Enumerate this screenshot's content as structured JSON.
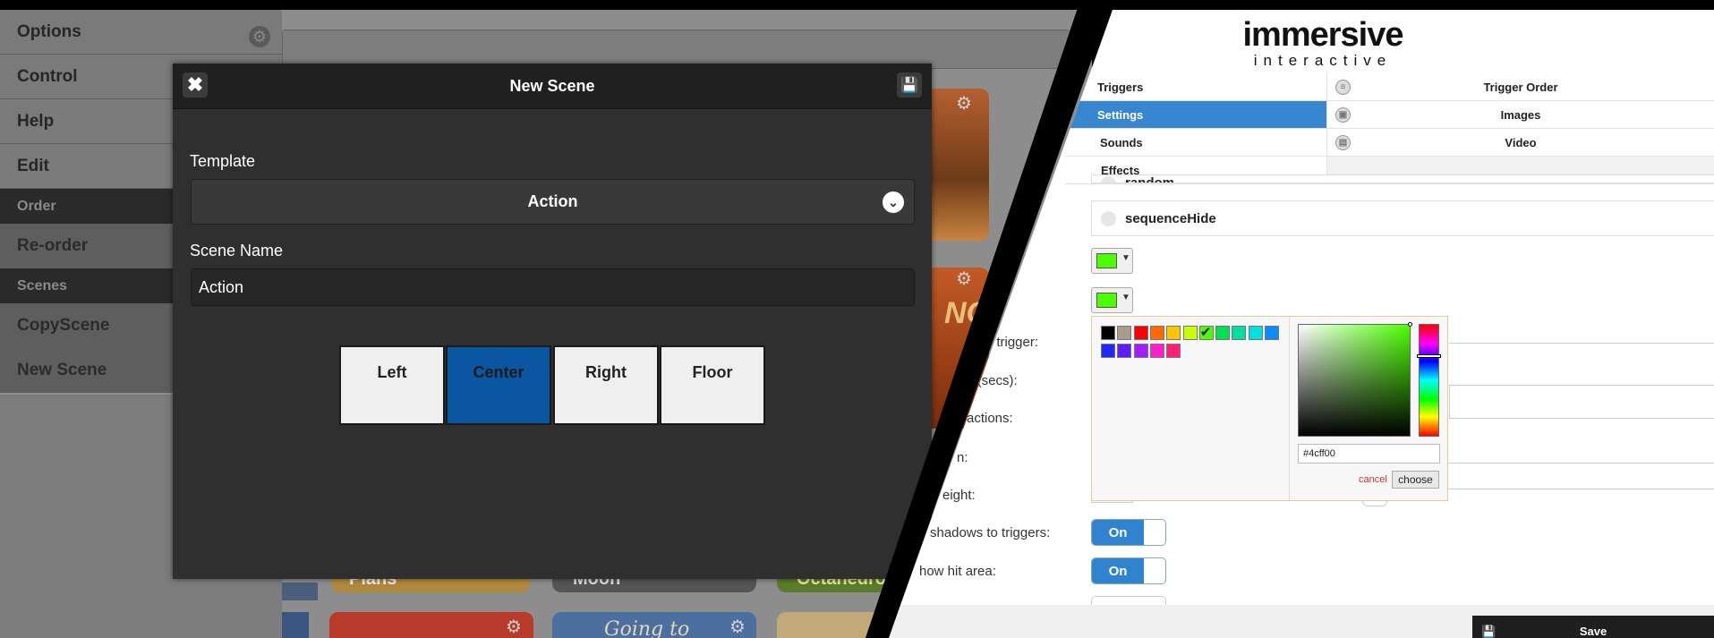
{
  "left": {
    "sidebar": {
      "items": [
        {
          "label": "Options"
        },
        {
          "label": "Control"
        },
        {
          "label": "Help"
        },
        {
          "label": "Edit"
        }
      ],
      "order_header": "Order",
      "reorder_label": "Re-order",
      "scenes_header": "Scenes",
      "copy_scene_label": "CopyScene",
      "new_scene_label": "New Scene"
    },
    "thumbnails": [
      {
        "label": "Plans"
      },
      {
        "label": "Moon"
      },
      {
        "label": "Octahedron"
      },
      {
        "label": "Going to"
      },
      {
        "label": "NO"
      }
    ]
  },
  "modal": {
    "title": "New Scene",
    "template_label": "Template",
    "template_value": "Action",
    "scene_name_label": "Scene Name",
    "scene_name_value": "Action",
    "positions": [
      {
        "label": "Left",
        "active": false
      },
      {
        "label": "Center",
        "active": true
      },
      {
        "label": "Right",
        "active": false
      },
      {
        "label": "Floor",
        "active": false
      }
    ],
    "colors": {
      "active": "#0a56a0",
      "header": "#202020",
      "body": "#2f2f2f"
    }
  },
  "right": {
    "logo": {
      "top": "immersive",
      "bottom": "interactive"
    },
    "tabs_left": [
      {
        "label": "Triggers",
        "selected": false
      },
      {
        "label": "Settings",
        "selected": true
      },
      {
        "label": "Sounds",
        "selected": false
      },
      {
        "label": "Effects",
        "selected": false
      }
    ],
    "tabs_right": [
      {
        "label": "Trigger Order",
        "icon": "list-icon"
      },
      {
        "label": "Images",
        "icon": "image-icon"
      },
      {
        "label": "Video",
        "icon": "film-icon"
      }
    ],
    "radio_options": [
      {
        "label": "random"
      },
      {
        "label": "sequenceHide"
      }
    ],
    "field_labels": [
      "s for trigger:",
      "for (secs):",
      "actions:",
      "n:",
      "eight:",
      "shadows to triggers:",
      "how hit area:"
    ],
    "toggles": [
      {
        "label": "On"
      },
      {
        "label": "On"
      }
    ],
    "color_picker": {
      "hex_value": "#4cff00",
      "cancel_label": "cancel",
      "choose_label": "choose",
      "selected_color": "#4cff00",
      "palette": [
        "#000000",
        "#a89c8a",
        "#ff0000",
        "#ff6a00",
        "#ffc400",
        "#c8ff00",
        "#4cff00",
        "#00e050",
        "#00e0a0",
        "#00e0e0",
        "#0a8cff",
        "#1e28ff",
        "#5a1eff",
        "#a51eff",
        "#ff1ecc",
        "#ff1e78"
      ]
    },
    "save_label": "Save",
    "accent": "#3787d0"
  }
}
